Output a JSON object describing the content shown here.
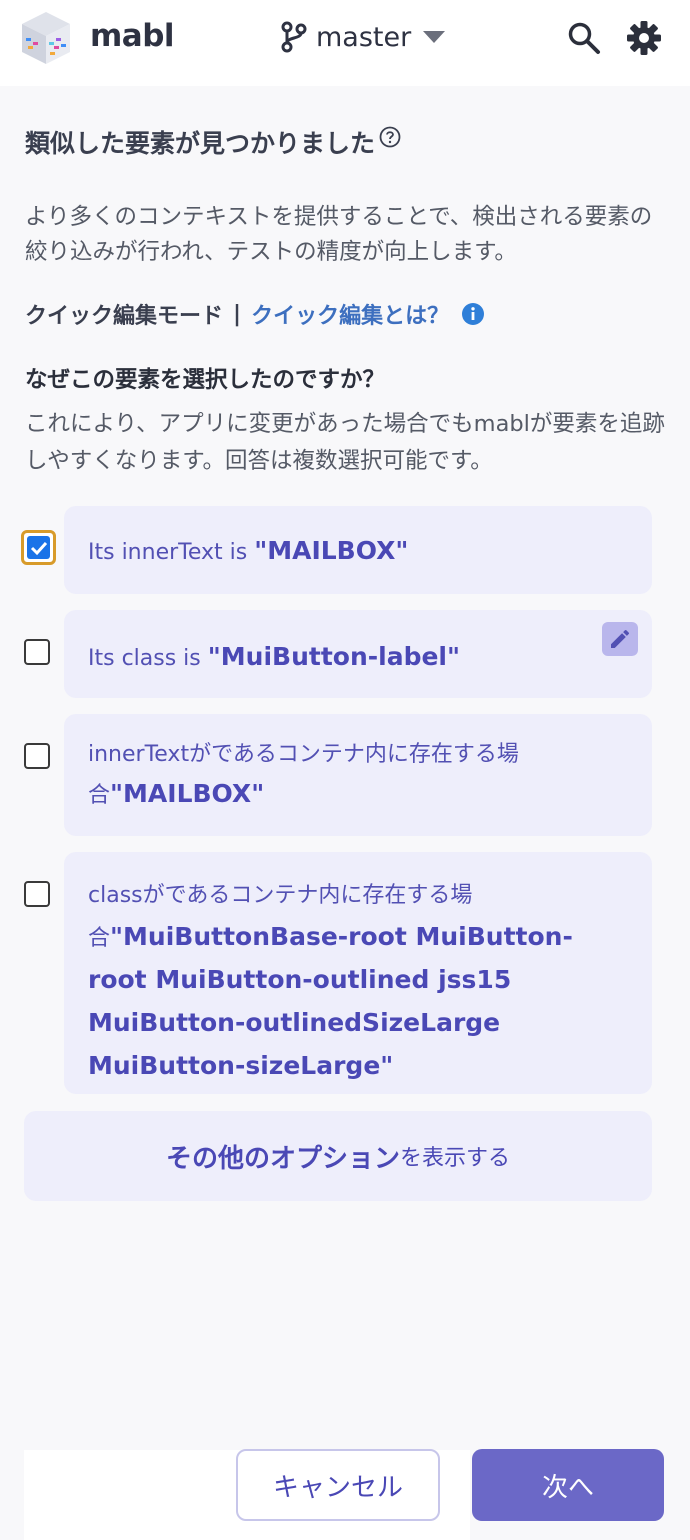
{
  "header": {
    "brand": "mabl",
    "branch_name": "master",
    "icons": [
      "mabl-logo-icon",
      "git-branch-icon",
      "chevron-down-icon",
      "search-icon",
      "gear-icon"
    ]
  },
  "page": {
    "title": "類似した要素が見つかりました",
    "description": "より多くのコンテキストを提供することで、検出される要素の絞り込みが行われ、テストの精度が向上します。",
    "quick_edit_mode": "クイック編集モード",
    "separator": "|",
    "quick_edit_link": "クイック編集とは？",
    "question": "なぜこの要素を選択したのですか？",
    "question_description": "これにより、アプリに変更があった場合でもmablが要素を追跡しやすくなります。回答は複数選択可能です。"
  },
  "options": [
    {
      "label": "Its innerText is ",
      "value": "\"MAILBOX\"",
      "checked": true
    },
    {
      "label": "Its class is ",
      "value": "\"MuiButton-label\"",
      "checked": false
    },
    {
      "label": "innerTextがであるコンテナ内に存在する場合",
      "value": "\"MAILBOX\"",
      "checked": false
    },
    {
      "label": "classがであるコンテナ内に存在する場合",
      "value": "\"MuiButtonBase-root MuiButton-root MuiButton-outlined jss15 MuiButton-outlinedSizeLarge MuiButton-sizeLarge\"",
      "checked": false
    }
  ],
  "more_options": {
    "strong": "その他のオプション",
    "rest": "を表示する"
  },
  "footer": {
    "cancel_label": "キャンセル",
    "next_label": "次へ"
  },
  "colors": {
    "accent": "#6b68c7",
    "card_bg": "#eeeefb",
    "link": "#3d6fbf",
    "checkbox_focus": "#d89b2a",
    "checkbox_checked": "#1a73e8"
  }
}
